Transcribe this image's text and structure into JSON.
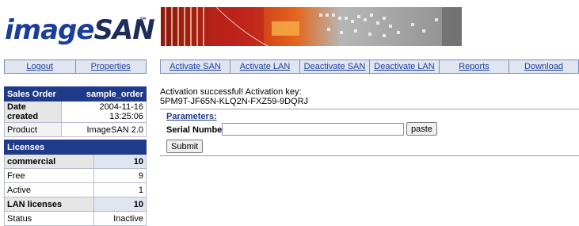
{
  "brand": {
    "logo_image": "image",
    "logo_san": "SAN",
    "logo_tm": "™"
  },
  "left_nav": [
    {
      "label": "Logout"
    },
    {
      "label": "Properties"
    }
  ],
  "top_nav": [
    {
      "label": "Activate SAN"
    },
    {
      "label": "Activate LAN"
    },
    {
      "label": "Deactivate SAN"
    },
    {
      "label": "Deactivate LAN"
    },
    {
      "label": "Reports"
    },
    {
      "label": "Download"
    }
  ],
  "sales": {
    "header_label": "Sales Order",
    "header_value": "sample_order",
    "rows": [
      {
        "label": "Date created",
        "value": "2004-11-16 13:25:06"
      },
      {
        "label": "Product",
        "value": "ImageSAN 2.0"
      }
    ]
  },
  "licenses": {
    "header": "Licenses",
    "rows": [
      {
        "label": "commercial",
        "value": "10"
      },
      {
        "label": "Free",
        "value": "9"
      },
      {
        "label": "Active",
        "value": "1"
      },
      {
        "label": "LAN licenses",
        "value": "10"
      },
      {
        "label": "Status",
        "value": "Inactive"
      }
    ]
  },
  "message": {
    "line1": "Activation successful! Activation key:",
    "key": "5PM9T-JF65N-KLQ2N-FXZ59-9DQRJ"
  },
  "params": {
    "title": "Parameters:",
    "serial_label": "Serial Number:",
    "serial_value": "",
    "paste_label": "paste",
    "submit_label": "Submit"
  }
}
